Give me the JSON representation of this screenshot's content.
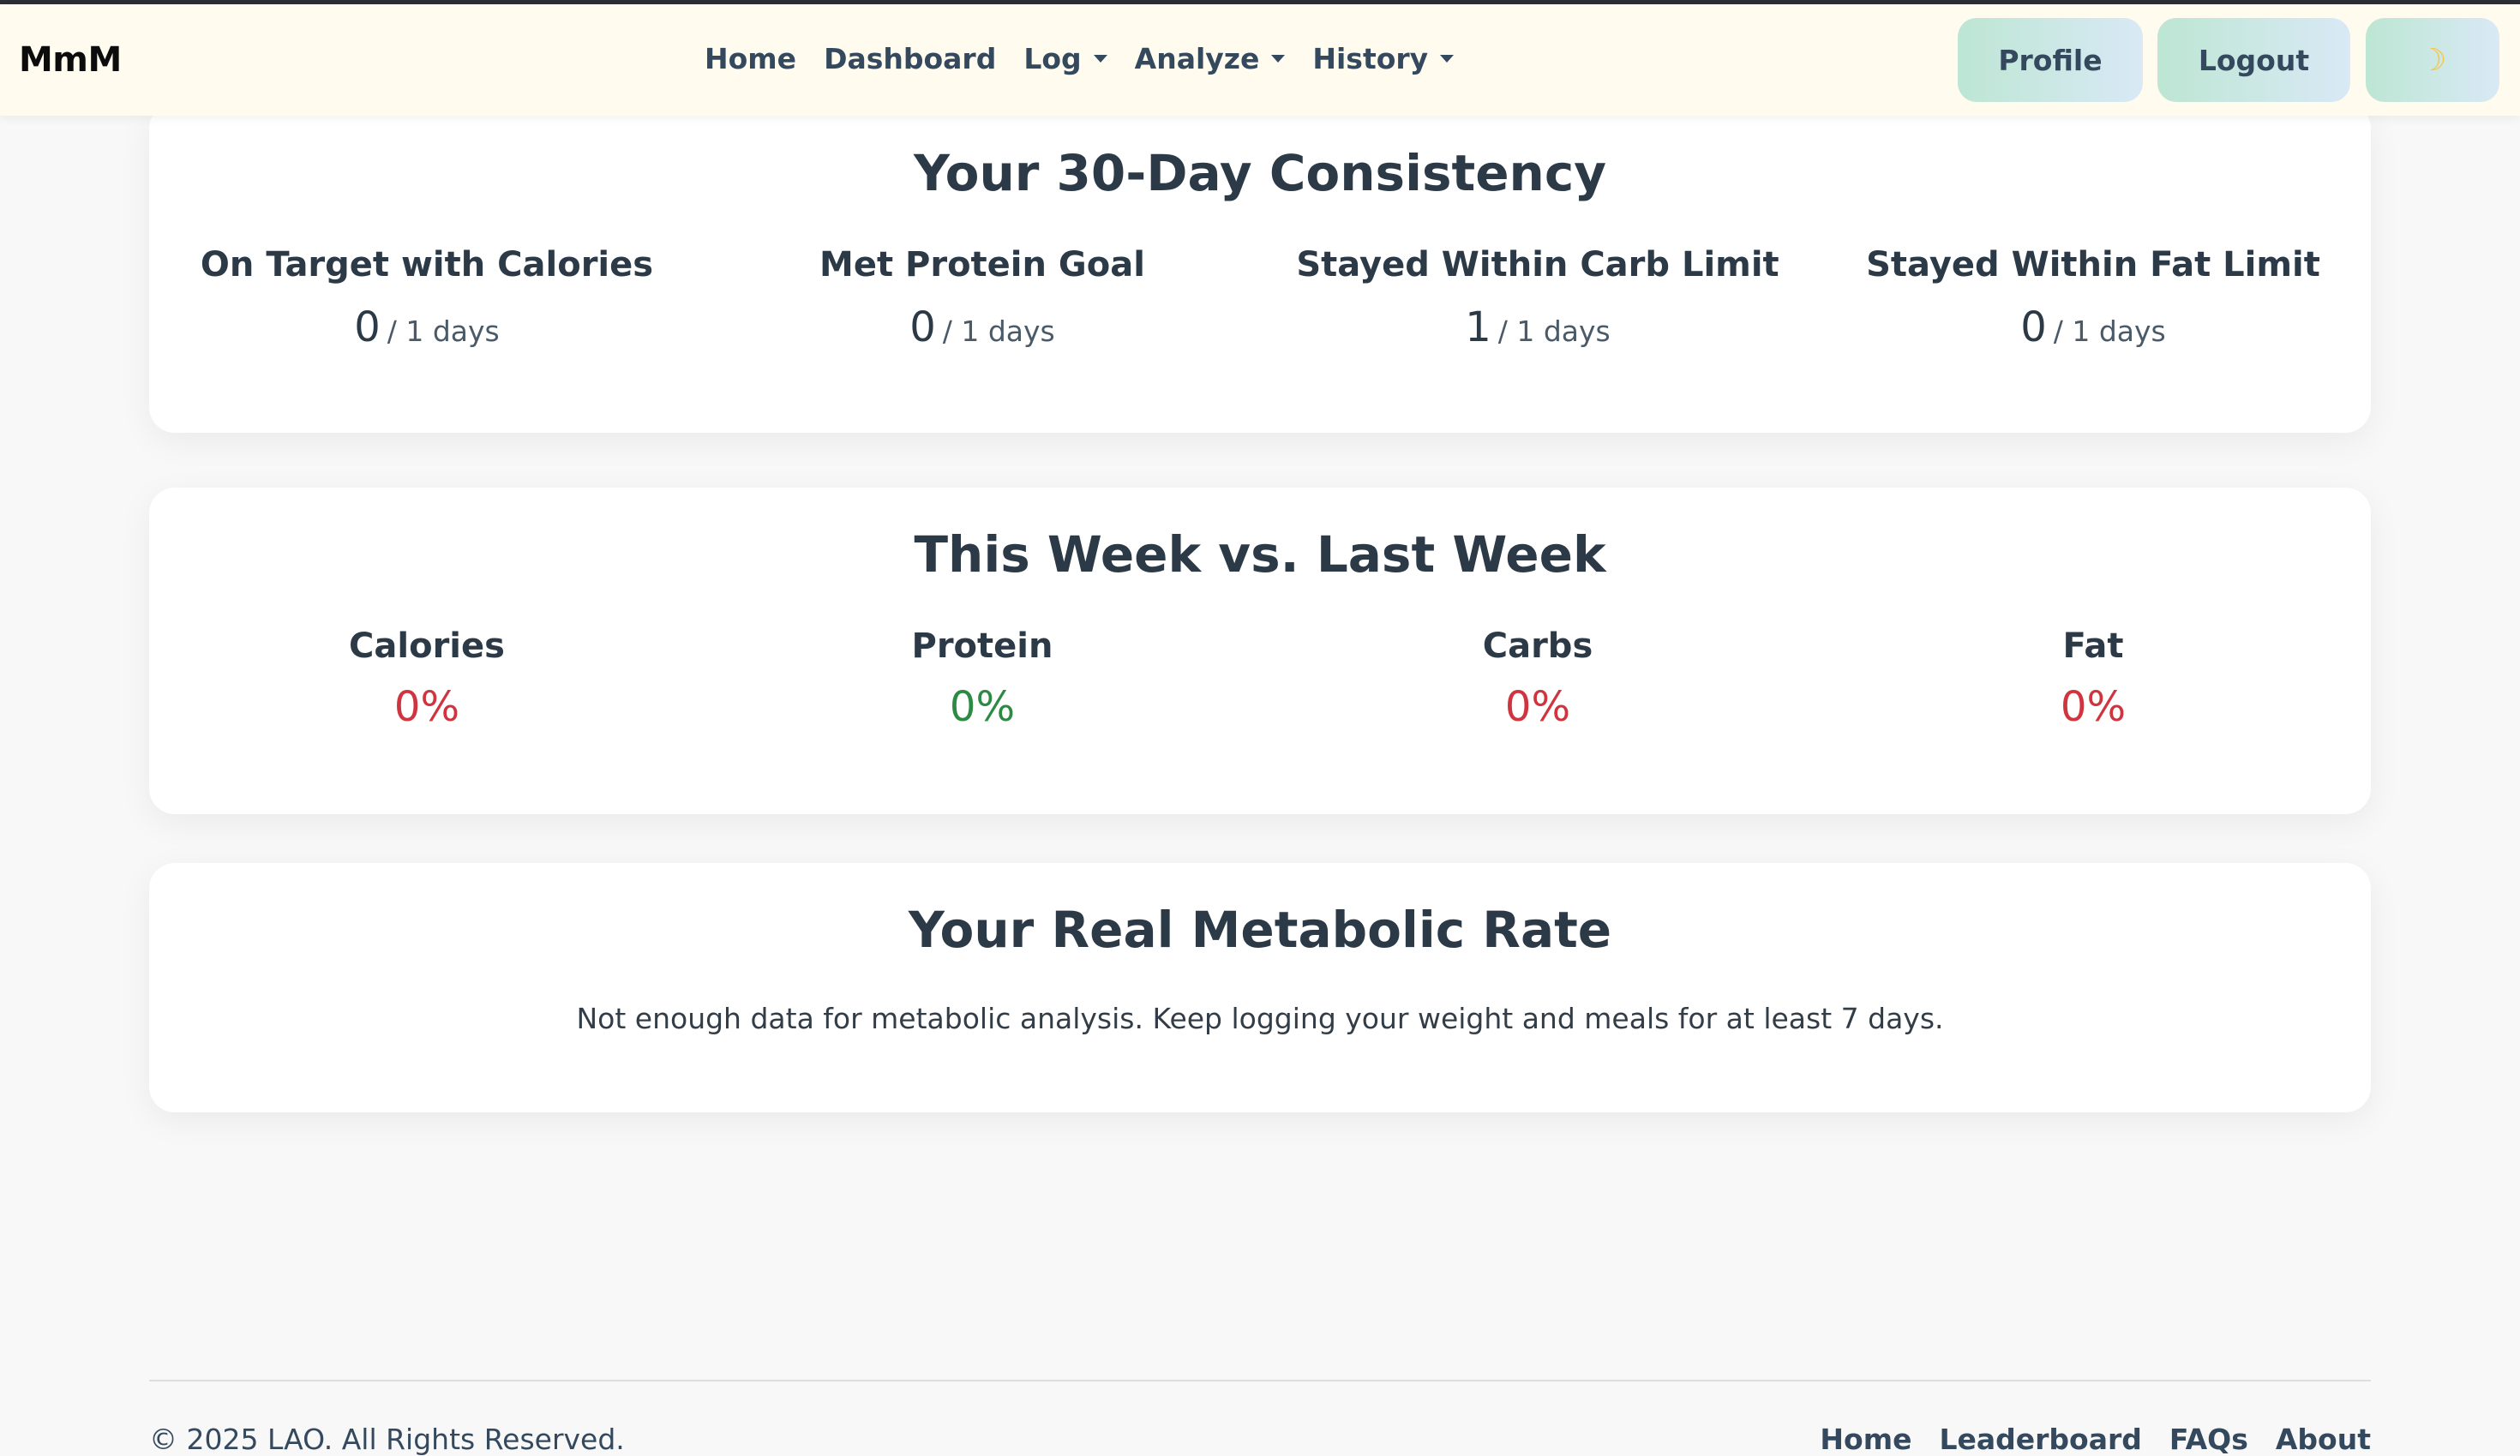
{
  "navbar": {
    "brand": "MmM",
    "links": [
      {
        "label": "Home",
        "dropdown": false
      },
      {
        "label": "Dashboard",
        "dropdown": false
      },
      {
        "label": "Log",
        "dropdown": true
      },
      {
        "label": "Analyze",
        "dropdown": true
      },
      {
        "label": "History",
        "dropdown": true
      }
    ],
    "profile_label": "Profile",
    "logout_label": "Logout",
    "theme_icon": "moon-icon",
    "theme_glyph": "☽"
  },
  "consistency": {
    "title": "Your 30-Day Consistency",
    "stats": [
      {
        "label": "On Target with Calories",
        "value": "0",
        "suffix": "/ 1 days"
      },
      {
        "label": "Met Protein Goal",
        "value": "0",
        "suffix": "/ 1 days"
      },
      {
        "label": "Stayed Within Carb Limit",
        "value": "1",
        "suffix": "/ 1 days"
      },
      {
        "label": "Stayed Within Fat Limit",
        "value": "0",
        "suffix": "/ 1 days"
      }
    ]
  },
  "week": {
    "title": "This Week vs. Last Week",
    "stats": [
      {
        "label": "Calories",
        "value": "0%",
        "status": "red"
      },
      {
        "label": "Protein",
        "value": "0%",
        "status": "green"
      },
      {
        "label": "Carbs",
        "value": "0%",
        "status": "red"
      },
      {
        "label": "Fat",
        "value": "0%",
        "status": "red"
      }
    ]
  },
  "metabolic": {
    "title": "Your Real Metabolic Rate",
    "message": "Not enough data for metabolic analysis. Keep logging your weight and meals for at least 7 days."
  },
  "footer": {
    "copyright": "© 2025 LAO. All Rights Reserved.",
    "links": [
      "Home",
      "Leaderboard",
      "FAQs",
      "About"
    ]
  },
  "colors": {
    "navbar_bg": "#fffcef",
    "button_gradient_start": "#bde6d3",
    "button_gradient_end": "#d9e9f6",
    "negative": "#d0343e",
    "positive": "#2c8a43",
    "text_primary": "#2c3a47"
  }
}
